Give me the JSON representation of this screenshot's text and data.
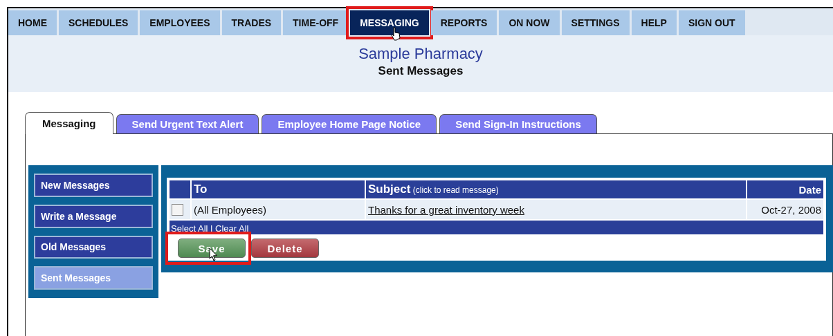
{
  "nav": [
    {
      "label": "HOME",
      "selected": false
    },
    {
      "label": "SCHEDULES",
      "selected": false
    },
    {
      "label": "EMPLOYEES",
      "selected": false
    },
    {
      "label": "TRADES",
      "selected": false
    },
    {
      "label": "TIME-OFF",
      "selected": false
    },
    {
      "label": "MESSAGING",
      "selected": true,
      "highlighted": true
    },
    {
      "label": "REPORTS",
      "selected": false
    },
    {
      "label": "ON NOW",
      "selected": false
    },
    {
      "label": "SETTINGS",
      "selected": false
    },
    {
      "label": "HELP",
      "selected": false
    },
    {
      "label": "SIGN OUT",
      "selected": false
    }
  ],
  "header": {
    "company": "Sample Pharmacy",
    "page_title": "Sent Messages"
  },
  "tabs": [
    {
      "label": "Messaging",
      "selected": true
    },
    {
      "label": "Send Urgent Text Alert",
      "selected": false
    },
    {
      "label": "Employee Home Page Notice",
      "selected": false
    },
    {
      "label": "Send Sign-In Instructions",
      "selected": false
    }
  ],
  "sidebar": [
    {
      "label": "New Messages",
      "selected": false
    },
    {
      "label": "Write a Message",
      "selected": false
    },
    {
      "label": "Old Messages",
      "selected": false
    },
    {
      "label": "Sent Messages",
      "selected": true
    }
  ],
  "table": {
    "columns": [
      "To",
      "**Subject** (click to read message)",
      "Date"
    ],
    "rows": [
      {
        "checked": false,
        "to": "(All Employees)",
        "subject": "Thanks for a great inventory week",
        "date": "Oct-27, 2008"
      }
    ],
    "footer": "Select All | Clear All"
  },
  "buttons": [
    {
      "label": "Save",
      "kind": "save",
      "highlighted": true
    },
    {
      "label": "Delete",
      "kind": "delete",
      "highlighted": false
    }
  ]
}
